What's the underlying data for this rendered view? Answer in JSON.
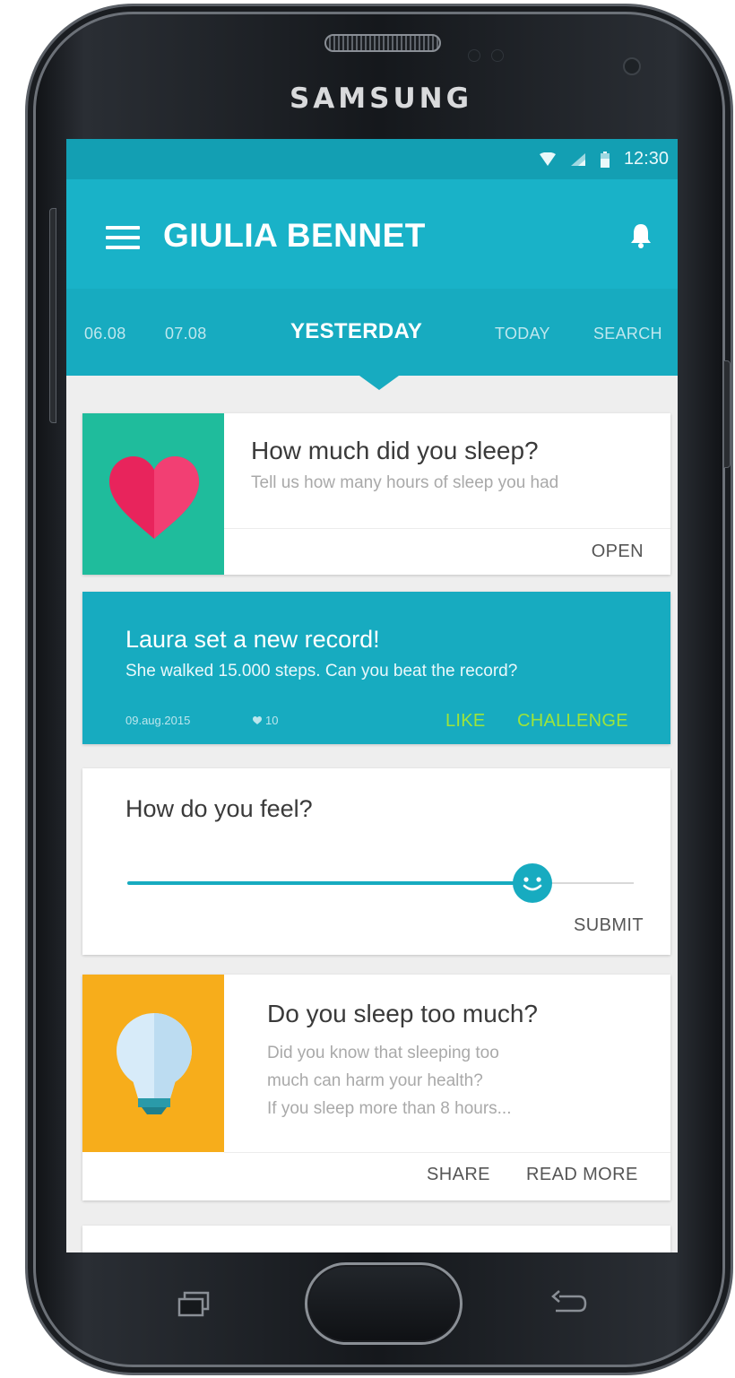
{
  "device": {
    "brand": "SAMSUNG"
  },
  "status_bar": {
    "time": "12:30",
    "icons": [
      "wifi-icon",
      "signal-icon",
      "battery-icon"
    ]
  },
  "app_bar": {
    "title": "GIULIA BENNET",
    "left_icon": "menu-icon",
    "right_icon": "bell-icon"
  },
  "tabs": [
    {
      "label": "06.08",
      "active": false
    },
    {
      "label": "07.08",
      "active": false
    },
    {
      "label": "YESTERDAY",
      "active": true
    },
    {
      "label": "TODAY",
      "active": false
    },
    {
      "label": "SEARCH",
      "active": false
    }
  ],
  "cards": {
    "sleep_question": {
      "icon": "heart-icon",
      "title": "How much did you sleep?",
      "subtitle": "Tell us how many hours of sleep you had",
      "action": "OPEN"
    },
    "record": {
      "title": "Laura set a new record!",
      "subtitle": "She walked 15.000 steps. Can you beat the record?",
      "date": "09.aug.2015",
      "likes": "10",
      "actions": [
        "LIKE",
        "CHALLENGE"
      ]
    },
    "feel": {
      "title": "How do you feel?",
      "slider_value": 0.8,
      "thumb_icon": "smiley-icon",
      "action": "SUBMIT"
    },
    "article": {
      "icon": "lightbulb-icon",
      "title": "Do you sleep too much?",
      "lines": [
        "Did you know that sleeping too",
        "much can harm your health?",
        "If you sleep more than 8 hours..."
      ],
      "actions": [
        "SHARE",
        "READ MORE"
      ]
    }
  },
  "colors": {
    "primary": "#19b2c8",
    "primary_dark": "#139fb3",
    "accent_green": "#9ee43a",
    "heart_tile": "#1fbc9c",
    "bulb_tile": "#f7ad1b",
    "heart": "#e8245c"
  },
  "nav_keys": [
    "recent-apps-icon",
    "home-button",
    "back-icon"
  ]
}
